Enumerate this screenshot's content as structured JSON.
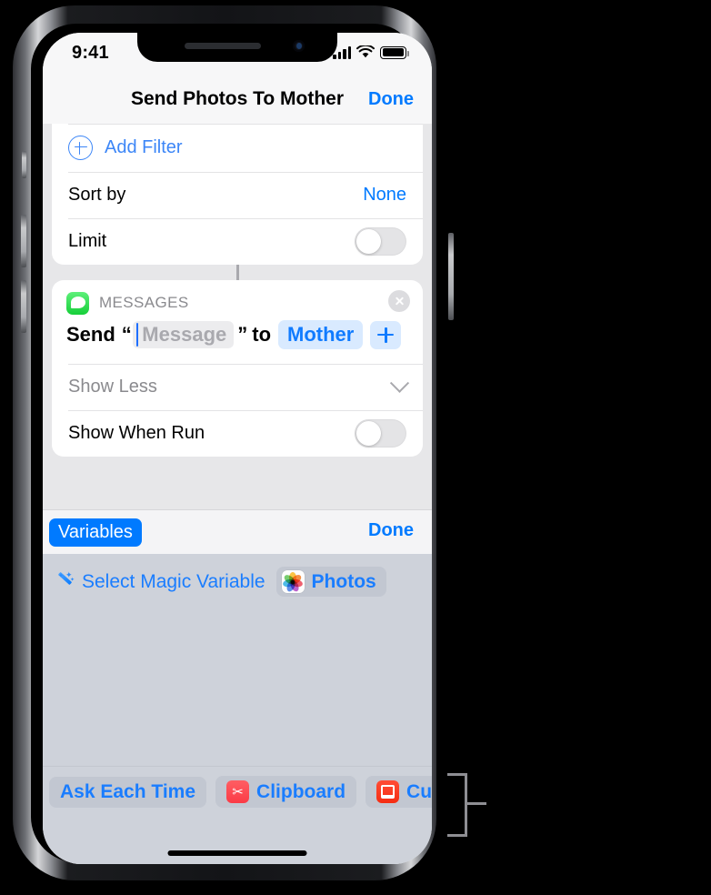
{
  "status_bar": {
    "time": "9:41",
    "cellular_icon": "signal-bars-icon",
    "wifi_icon": "wifi-icon",
    "battery_icon": "battery-full-icon"
  },
  "nav_bar": {
    "title": "Send Photos To Mother",
    "done_label": "Done"
  },
  "filter_card": {
    "add_filter_label": "Add Filter",
    "add_filter_icon": "plus-circle-icon",
    "sort_by_label": "Sort by",
    "sort_by_value": "None",
    "limit_label": "Limit",
    "limit_toggle_state": "off"
  },
  "messages_card": {
    "app_name": "MESSAGES",
    "app_icon": "messages-app-icon",
    "close_icon": "close-circle-icon",
    "sentence": {
      "send_word": "Send",
      "open_quote": "“",
      "message_placeholder": "Message",
      "close_quote": "”",
      "to_word": "to",
      "recipient_chip": "Mother",
      "add_recipient_icon": "plus-icon"
    },
    "show_less_label": "Show Less",
    "chevron_icon": "chevron-down-icon",
    "show_when_run_label": "Show When Run",
    "show_when_run_toggle_state": "off"
  },
  "variables_bar": {
    "variables_button_label": "Variables",
    "done_label": "Done"
  },
  "variable_panel": {
    "magic_wand_icon": "magic-wand-icon",
    "select_magic_variable_label": "Select Magic Variable",
    "photos_chip": {
      "icon": "photos-app-icon",
      "label": "Photos"
    },
    "bottom_chips": [
      {
        "label": "Ask Each Time",
        "icon": null
      },
      {
        "label": "Clipboard",
        "icon": "clipboard-scissors-icon"
      },
      {
        "label": "Current D",
        "icon": "current-date-icon"
      }
    ]
  },
  "device": {
    "home_indicator": "home-indicator",
    "notch_speaker": "speaker-grille",
    "notch_camera": "front-camera"
  },
  "colors": {
    "accent_blue": "#007aff",
    "link_blue": "#1a7dff",
    "chip_blue_bg": "#d9eaff",
    "messages_green": "#16cf39",
    "panel_gray": "#ced2da",
    "content_gray": "#e7e7e9",
    "muted_text": "#8a8a8e",
    "clipboard_red": "#fb3b46",
    "date_red": "#f52d12"
  }
}
